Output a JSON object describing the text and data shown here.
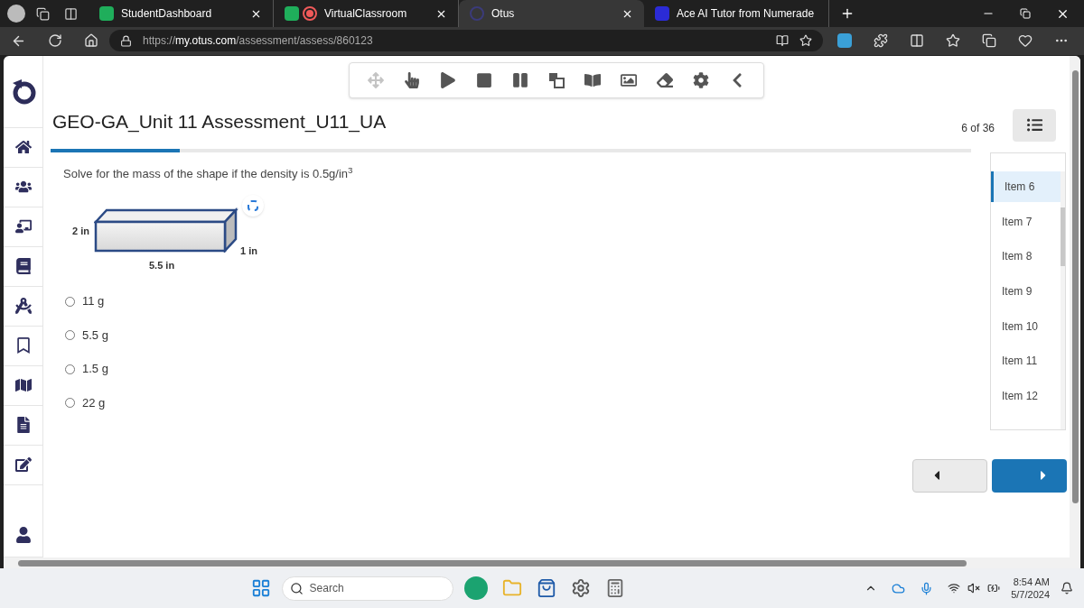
{
  "browser": {
    "tabs": [
      {
        "label": "StudentDashboard",
        "kind": "green",
        "selected": false
      },
      {
        "label": "VirtualClassroom",
        "kind": "record",
        "selected": false
      },
      {
        "label": "Otus",
        "kind": "otus",
        "selected": true
      },
      {
        "label": "Ace AI Tutor from Numerade",
        "kind": "numerade",
        "selected": false
      }
    ],
    "url": {
      "scheme": "https://",
      "host": "my.otus.com",
      "path": "/assessment/assess/860123"
    }
  },
  "toolbar": [
    {
      "kind": "move",
      "disabled": true
    },
    {
      "kind": "pointer",
      "disabled": false
    },
    {
      "kind": "play",
      "disabled": false
    },
    {
      "kind": "stop",
      "disabled": false
    },
    {
      "kind": "pause",
      "disabled": false
    },
    {
      "kind": "translate",
      "disabled": false
    },
    {
      "kind": "book",
      "disabled": false
    },
    {
      "kind": "image",
      "disabled": false
    },
    {
      "kind": "eraser",
      "disabled": false
    },
    {
      "kind": "settings",
      "disabled": false
    },
    {
      "kind": "collapse",
      "disabled": false
    }
  ],
  "sidebar": [
    {
      "kind": "home"
    },
    {
      "kind": "users"
    },
    {
      "kind": "teacher"
    },
    {
      "kind": "book"
    },
    {
      "kind": "compass"
    },
    {
      "kind": "bookmark"
    },
    {
      "kind": "map"
    },
    {
      "kind": "file"
    },
    {
      "kind": "edit"
    },
    {
      "kind": "user"
    }
  ],
  "assessment": {
    "title": "GEO-GA_Unit 11 Assessment_U11_UA",
    "progress": {
      "level": 0.14
    },
    "counter": "6 of 36",
    "question": "Solve for the mass of the shape if the density is 0.5g/in$^{3}$",
    "figure": {
      "height": "2 in",
      "length": "5.5 in",
      "depth": "1 in"
    },
    "options": [
      {
        "label": "11 g",
        "selected": false
      },
      {
        "label": "5.5 g",
        "selected": false
      },
      {
        "label": "1.5 g",
        "selected": false
      },
      {
        "label": "22 g",
        "selected": false
      }
    ],
    "items": [
      {
        "label": "Item 6",
        "selected": true
      },
      {
        "label": "Item 7",
        "selected": false
      },
      {
        "label": "Item 8",
        "selected": false
      },
      {
        "label": "Item 9",
        "selected": false
      },
      {
        "label": "Item 10",
        "selected": false
      },
      {
        "label": "Item 11",
        "selected": false
      },
      {
        "label": "Item 12",
        "selected": false
      }
    ]
  },
  "taskbar": {
    "search": {
      "placeholder": "Search"
    },
    "time": "8:54 AM",
    "date": "5/7/2024"
  }
}
